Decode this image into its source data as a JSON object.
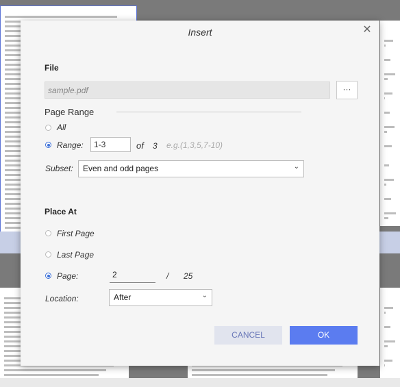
{
  "dialog": {
    "title": "Insert",
    "close_icon": "close-icon"
  },
  "file": {
    "label": "File",
    "value": "sample.pdf",
    "browse_label": "···"
  },
  "page_range": {
    "label": "Page Range",
    "all_label": "All",
    "range_label": "Range:",
    "range_value": "1-3",
    "of_label": "of",
    "total": "3",
    "hint": "e.g.(1,3,5,7-10)",
    "selected": "range",
    "subset_label": "Subset:",
    "subset_value": "Even and odd pages"
  },
  "place_at": {
    "label": "Place At",
    "first_page_label": "First Page",
    "last_page_label": "Last Page",
    "page_label": "Page:",
    "page_value": "2",
    "slash": "/",
    "page_total": "25",
    "selected": "page",
    "location_label": "Location:",
    "location_value": "After"
  },
  "buttons": {
    "cancel": "CANCEL",
    "ok": "OK"
  },
  "colors": {
    "accent": "#5b7cf0",
    "radio_on": "#3b6fd8"
  }
}
